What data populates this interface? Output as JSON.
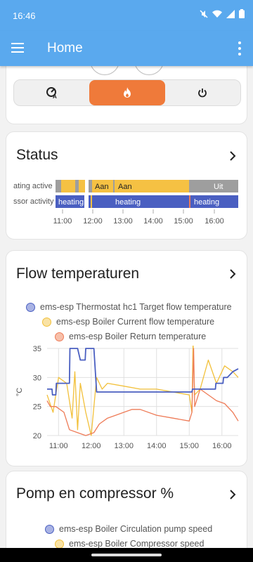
{
  "statusbar": {
    "time": "16:46"
  },
  "appbar": {
    "title": "Home"
  },
  "thermostat_card": {
    "minus": "−",
    "plus": "+"
  },
  "status_card": {
    "title": "Status",
    "rows": [
      {
        "label": "ating active",
        "segments": [
          "Aan",
          "Aan",
          "Uit"
        ]
      },
      {
        "label": "ssor activity",
        "segments": [
          "heating",
          "heating",
          "heating"
        ]
      }
    ],
    "ticks": [
      "11:00",
      "12:00",
      "13:00",
      "14:00",
      "15:00",
      "16:00"
    ]
  },
  "flow_card": {
    "title": "Flow temperaturen",
    "legend": [
      {
        "label": "ems-esp Thermostat hc1 Target flow temperature",
        "color": "#4a5fc1"
      },
      {
        "label": "ems-esp Boiler Current flow temperature",
        "color": "#f2c03a"
      },
      {
        "label": "ems-esp Boiler Return temperature",
        "color": "#ee7b57"
      }
    ]
  },
  "chart_data": {
    "type": "line",
    "xlabel": "",
    "ylabel": "°C",
    "ylim": [
      20,
      35
    ],
    "y_ticks": [
      "35",
      "30",
      "25",
      "20"
    ],
    "x_ticks": [
      "11:00",
      "12:00",
      "13:00",
      "14:00",
      "15:00",
      "16:00"
    ],
    "series": [
      {
        "name": "ems-esp Thermostat hc1 Target flow temperature",
        "x": [
          "10:39",
          "10:48",
          "10:49",
          "10:55",
          "10:56",
          "11:20",
          "11:21",
          "11:35",
          "11:40",
          "11:49",
          "11:50",
          "12:05",
          "12:10",
          "15:05",
          "15:06",
          "15:48",
          "15:49",
          "16:02",
          "16:03",
          "16:10",
          "16:20",
          "16:30"
        ],
        "y": [
          28,
          28,
          27,
          27,
          29,
          29,
          35,
          35,
          33,
          33,
          35,
          35,
          27.5,
          27.5,
          28,
          28,
          29,
          29,
          30,
          30,
          31,
          31.5
        ]
      },
      {
        "name": "ems-esp Boiler Current flow temperature",
        "x": [
          "10:39",
          "10:50",
          "11:00",
          "11:15",
          "11:25",
          "11:30",
          "11:35",
          "11:40",
          "11:50",
          "12:00",
          "12:10",
          "12:20",
          "12:30",
          "13:00",
          "13:30",
          "14:00",
          "14:30",
          "15:00",
          "15:05",
          "15:07",
          "15:10",
          "15:20",
          "15:35",
          "15:50",
          "16:05",
          "16:20",
          "16:30"
        ],
        "y": [
          27,
          24,
          30,
          29,
          23,
          31,
          21,
          29,
          24,
          20,
          30,
          28,
          29,
          28.5,
          28,
          28,
          27.5,
          27,
          24,
          36,
          27,
          28,
          33,
          29,
          32,
          31,
          30
        ]
      },
      {
        "name": "ems-esp Boiler Return temperature",
        "x": [
          "10:39",
          "10:45",
          "10:55",
          "11:10",
          "11:20",
          "11:35",
          "11:50",
          "12:05",
          "12:15",
          "12:30",
          "12:45",
          "13:00",
          "13:15",
          "13:30",
          "14:00",
          "14:30",
          "15:00",
          "15:05",
          "15:08",
          "15:10",
          "15:20",
          "15:35",
          "15:50",
          "16:05",
          "16:20",
          "16:30"
        ],
        "y": [
          26,
          25,
          25,
          24,
          21,
          20.5,
          20,
          20.5,
          22,
          23,
          23.5,
          24,
          24.5,
          24.5,
          23.5,
          23,
          22.5,
          24,
          35,
          25,
          28,
          27,
          26,
          25.5,
          24,
          22.5
        ]
      }
    ]
  },
  "pump_card": {
    "title": "Pomp en compressor %",
    "legend": [
      {
        "label": "ems-esp Boiler Circulation pump speed",
        "color": "#4a5fc1"
      },
      {
        "label": "ems-esp Boiler Compressor speed",
        "color": "#f2c03a"
      }
    ]
  }
}
